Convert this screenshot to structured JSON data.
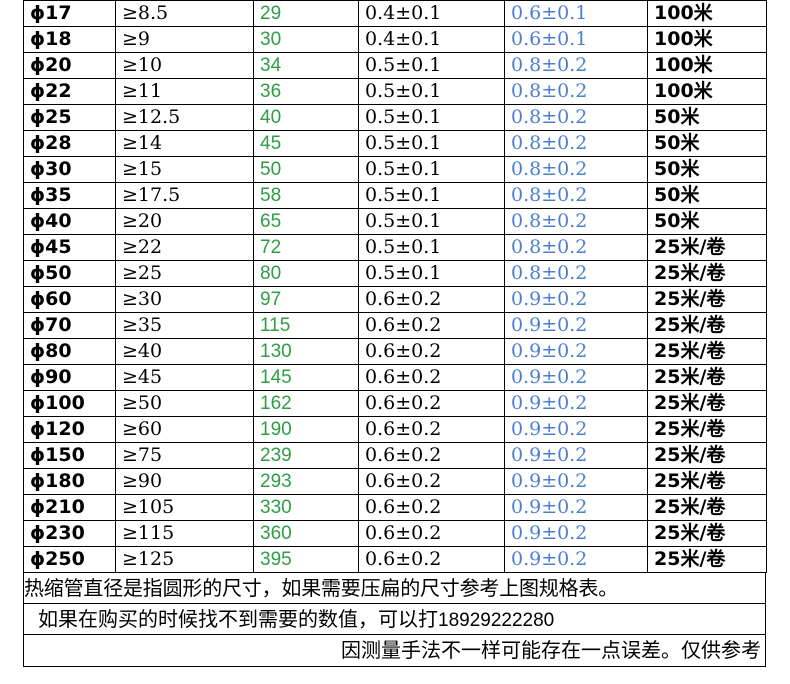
{
  "rows": [
    {
      "size": "ϕ17",
      "min": "≥8.5",
      "flat": "29",
      "wall": "0.4±0.1",
      "tol": "0.6±0.1",
      "pack": "100米"
    },
    {
      "size": "ϕ18",
      "min": "≥9",
      "flat": "30",
      "wall": "0.4±0.1",
      "tol": "0.6±0.1",
      "pack": "100米"
    },
    {
      "size": "ϕ20",
      "min": "≥10",
      "flat": "34",
      "wall": "0.5±0.1",
      "tol": "0.8±0.2",
      "pack": "100米"
    },
    {
      "size": "ϕ22",
      "min": "≥11",
      "flat": "36",
      "wall": "0.5±0.1",
      "tol": "0.8±0.2",
      "pack": "100米"
    },
    {
      "size": "ϕ25",
      "min": "≥12.5",
      "flat": "40",
      "wall": "0.5±0.1",
      "tol": "0.8±0.2",
      "pack": "50米"
    },
    {
      "size": "ϕ28",
      "min": "≥14",
      "flat": "45",
      "wall": "0.5±0.1",
      "tol": "0.8±0.2",
      "pack": "50米"
    },
    {
      "size": "ϕ30",
      "min": "≥15",
      "flat": "50",
      "wall": "0.5±0.1",
      "tol": "0.8±0.2",
      "pack": "50米"
    },
    {
      "size": "ϕ35",
      "min": "≥17.5",
      "flat": "58",
      "wall": "0.5±0.1",
      "tol": "0.8±0.2",
      "pack": "50米"
    },
    {
      "size": "ϕ40",
      "min": "≥20",
      "flat": "65",
      "wall": "0.5±0.1",
      "tol": "0.8±0.2",
      "pack": "50米"
    },
    {
      "size": "ϕ45",
      "min": "≥22",
      "flat": "72",
      "wall": "0.5±0.1",
      "tol": "0.8±0.2",
      "pack": "25米/卷"
    },
    {
      "size": "ϕ50",
      "min": "≥25",
      "flat": "80",
      "wall": "0.5±0.1",
      "tol": "0.8±0.2",
      "pack": "25米/卷"
    },
    {
      "size": "ϕ60",
      "min": "≥30",
      "flat": "97",
      "wall": "0.6±0.2",
      "tol": "0.9±0.2",
      "pack": "25米/卷"
    },
    {
      "size": "ϕ70",
      "min": "≥35",
      "flat": "115",
      "wall": "0.6±0.2",
      "tol": "0.9±0.2",
      "pack": "25米/卷"
    },
    {
      "size": "ϕ80",
      "min": "≥40",
      "flat": "130",
      "wall": "0.6±0.2",
      "tol": "0.9±0.2",
      "pack": "25米/卷"
    },
    {
      "size": "ϕ90",
      "min": "≥45",
      "flat": "145",
      "wall": "0.6±0.2",
      "tol": "0.9±0.2",
      "pack": "25米/卷"
    },
    {
      "size": "ϕ100",
      "min": "≥50",
      "flat": "162",
      "wall": "0.6±0.2",
      "tol": "0.9±0.2",
      "pack": "25米/卷"
    },
    {
      "size": "ϕ120",
      "min": "≥60",
      "flat": "190",
      "wall": "0.6±0.2",
      "tol": "0.9±0.2",
      "pack": "25米/卷"
    },
    {
      "size": "ϕ150",
      "min": "≥75",
      "flat": "239",
      "wall": "0.6±0.2",
      "tol": "0.9±0.2",
      "pack": "25米/卷"
    },
    {
      "size": "ϕ180",
      "min": "≥90",
      "flat": "293",
      "wall": "0.6±0.2",
      "tol": "0.9±0.2",
      "pack": "25米/卷"
    },
    {
      "size": "ϕ210",
      "min": "≥105",
      "flat": "330",
      "wall": "0.6±0.2",
      "tol": "0.9±0.2",
      "pack": "25米/卷"
    },
    {
      "size": "ϕ230",
      "min": "≥115",
      "flat": "360",
      "wall": "0.6±0.2",
      "tol": "0.9±0.2",
      "pack": "25米/卷"
    },
    {
      "size": "ϕ250",
      "min": "≥125",
      "flat": "395",
      "wall": "0.6±0.2",
      "tol": "0.9±0.2",
      "pack": "25米/卷"
    }
  ],
  "notes": {
    "line1": "热缩管直径是指圆形的尺寸，如果需要压扁的尺寸参考上图规格表。",
    "line2_text": "如果在购买的时候找不到需要的数值，可以打",
    "line2_phone": "18929222280",
    "line3": "因测量手法不一样可能存在一点误差。仅供参考"
  },
  "colors": {
    "flat_width": "#2e9e45",
    "tolerance": "#4b7fd0",
    "text": "#000000",
    "border": "#000000"
  }
}
